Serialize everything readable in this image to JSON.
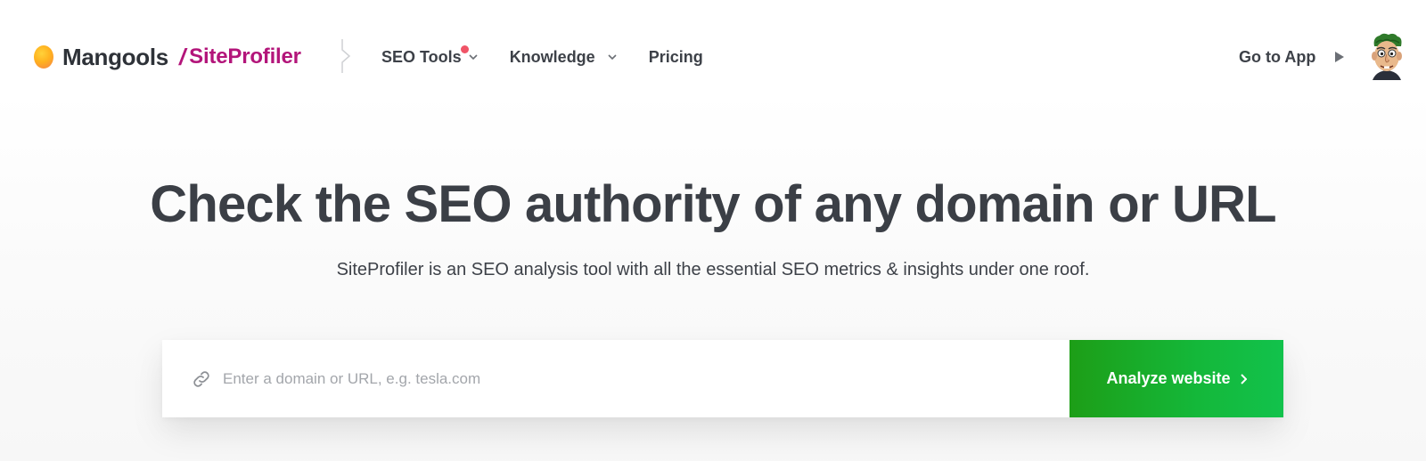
{
  "brand": {
    "name": "Mangools",
    "slash": "/",
    "product": "SiteProfiler",
    "accent_color": "#b3157a",
    "logo_icon": "mangools-ball-icon"
  },
  "nav": {
    "items": [
      {
        "label": "SEO Tools",
        "has_dropdown": true,
        "has_notification": true
      },
      {
        "label": "Knowledge",
        "has_dropdown": true,
        "has_notification": false
      },
      {
        "label": "Pricing",
        "has_dropdown": false,
        "has_notification": false
      }
    ],
    "go_to_app": "Go to App",
    "notification_color": "#f05467"
  },
  "hero": {
    "title": "Check the SEO authority of any domain or URL",
    "subtitle": "SiteProfiler is an SEO analysis tool with all the essential SEO metrics & insights under one roof."
  },
  "search": {
    "placeholder": "Enter a domain or URL, e.g. tesla.com",
    "value": "",
    "icon": "link-icon",
    "button_label": "Analyze website",
    "button_color": "#14b83a"
  }
}
